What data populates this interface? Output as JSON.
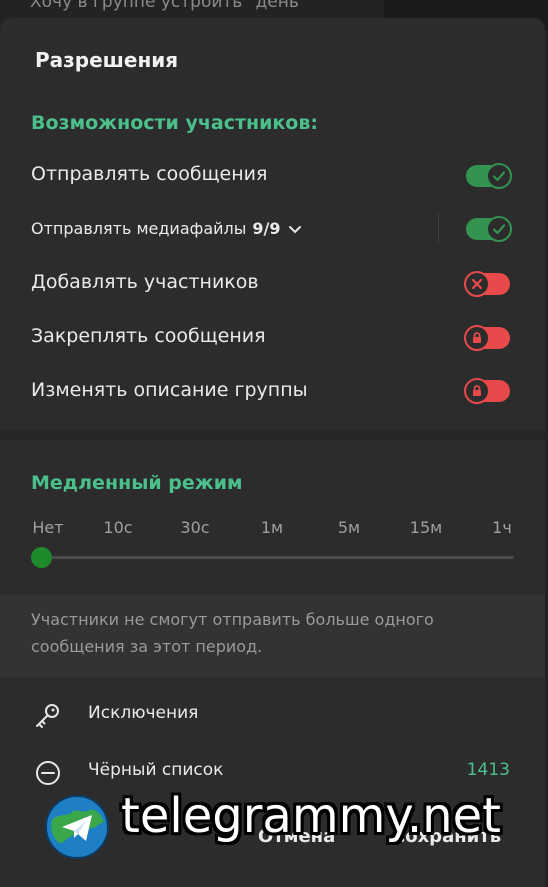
{
  "background": {
    "chat_snippet": "Хочу в группе устроить \"день"
  },
  "dialog": {
    "title": "Разрешения",
    "members_section": {
      "title": "Возможности участников:",
      "rows": [
        {
          "label": "Отправлять сообщения",
          "state": "on"
        },
        {
          "label": "Отправлять медиафайлы",
          "count": "9/9",
          "state": "on"
        },
        {
          "label": "Добавлять участников",
          "state": "off",
          "icon": "close-x-icon"
        },
        {
          "label": "Закреплять сообщения",
          "state": "locked",
          "icon": "lock-icon"
        },
        {
          "label": "Изменять описание группы",
          "state": "locked",
          "icon": "lock-icon"
        }
      ]
    },
    "slow_mode": {
      "title": "Медленный режим",
      "options": [
        "Нет",
        "10с",
        "30с",
        "1м",
        "5м",
        "15м",
        "1ч"
      ],
      "selected": "Нет",
      "hint": "Участники не смогут отправить больше одного сообщения за этот период."
    },
    "links": {
      "exceptions": {
        "label": "Исключения",
        "icon": "key-icon"
      },
      "blacklist": {
        "label": "Чёрный список",
        "count": "1413",
        "icon": "minus-circle-icon"
      }
    },
    "footer": {
      "cancel": "Отмена",
      "save": "Сохранить"
    }
  },
  "watermark": {
    "text": "telegrammy.net"
  },
  "colors": {
    "accent": "#4bc08b",
    "toggle_on": "#33934f",
    "toggle_off": "#e8494b",
    "dialog_bg": "#2c2c2c"
  }
}
